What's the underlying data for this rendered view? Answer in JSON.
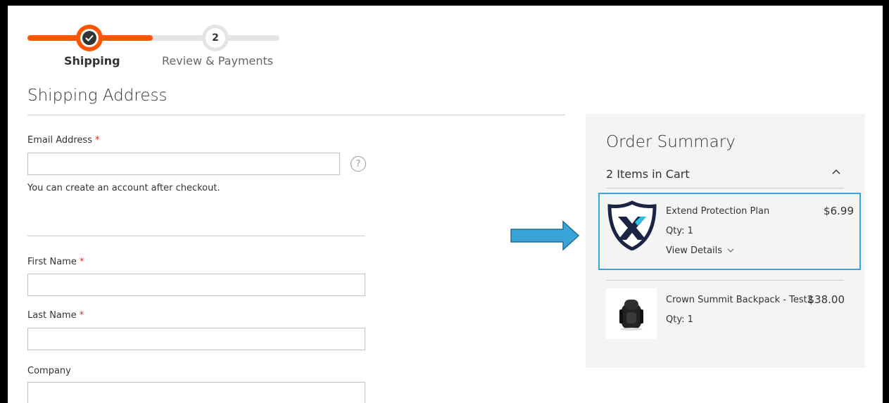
{
  "progress": {
    "steps": [
      {
        "label": "Shipping",
        "state": "complete"
      },
      {
        "label": "Review & Payments",
        "number": "2",
        "state": "pending"
      }
    ],
    "accent_color": "#ff5501"
  },
  "shipping": {
    "title": "Shipping Address",
    "email": {
      "label": "Email Address",
      "required": "*",
      "value": ""
    },
    "note": "You can create an account after checkout.",
    "first_name": {
      "label": "First Name",
      "required": "*",
      "value": ""
    },
    "last_name": {
      "label": "Last Name",
      "required": "*",
      "value": ""
    },
    "company": {
      "label": "Company",
      "value": ""
    },
    "help_icon": "?"
  },
  "summary": {
    "title": "Order Summary",
    "items_count": "2 Items in Cart",
    "toggle_icon": "chevron-up-icon",
    "items": [
      {
        "name": "Extend Protection Plan",
        "price": "$6.99",
        "qty": "Qty: 1",
        "details_label": "View Details",
        "thumb_icon": "extend-shield-logo-icon"
      },
      {
        "name": "Crown Summit Backpack - Test2",
        "price": "$38.00",
        "qty": "Qty: 1",
        "thumb_icon": "backpack-image"
      }
    ],
    "highlight_color": "#3aa3d8"
  },
  "annotation": {
    "arrow_icon": "right-arrow-icon",
    "arrow_color": "#3aa3d8"
  }
}
